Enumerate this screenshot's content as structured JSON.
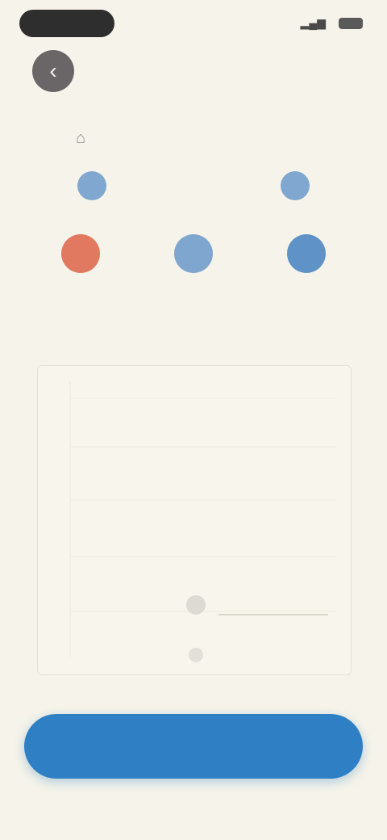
{
  "status": {
    "time": "",
    "signal": "",
    "battery": ""
  },
  "header": {
    "back_icon": "back-arrow-icon",
    "title": ""
  },
  "route": {
    "icon": "bus-icon",
    "text": ""
  },
  "top_markers": {
    "left": "",
    "middle_label": "",
    "right": ""
  },
  "stops": [
    {
      "marker_color": "#e0795f",
      "marker_label": "",
      "num": "",
      "name": ""
    },
    {
      "marker_color": "#7ea6cf",
      "marker_label": "",
      "num": "",
      "name": ""
    },
    {
      "marker_color": "#5f93c8",
      "marker_label": "",
      "num": "",
      "name": ""
    }
  ],
  "chart": {
    "ticks": [
      "",
      "",
      "",
      "",
      "",
      ""
    ],
    "point_label": ""
  },
  "book_button": {
    "label": ""
  },
  "footer": {
    "left": "",
    "right": ""
  },
  "colors": {
    "background": "#f6f4ea",
    "accent": "#2f7fc4",
    "origin": "#e0795f"
  }
}
